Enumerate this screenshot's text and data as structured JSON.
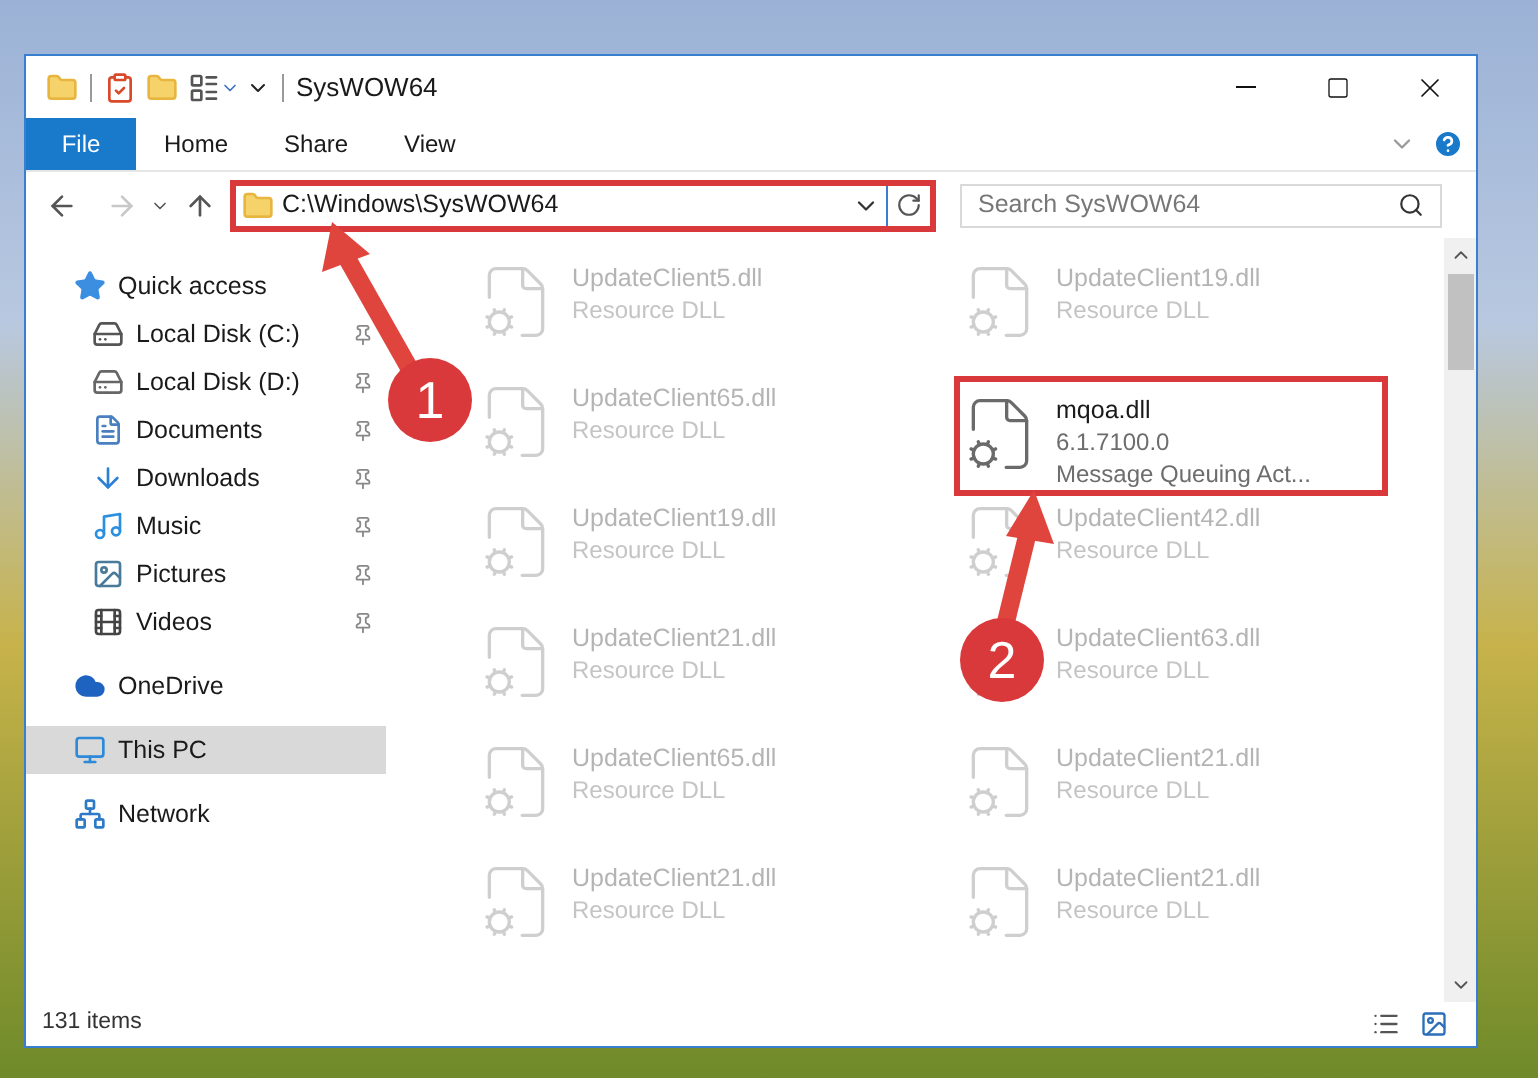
{
  "window": {
    "title": "SysWOW64"
  },
  "ribbon": {
    "file_tab": "File",
    "tabs": [
      "Home",
      "Share",
      "View"
    ]
  },
  "address_bar": {
    "path": "C:\\Windows\\SysWOW64",
    "highlighted": true
  },
  "search": {
    "placeholder": "Search SysWOW64"
  },
  "navigation": [
    {
      "label": "Quick access",
      "kind": "star",
      "selected": false,
      "children": [
        {
          "label": "Local Disk (C:)",
          "kind": "system-drive",
          "pinned": true,
          "selected": false
        },
        {
          "label": "Local Disk (D:)",
          "kind": "drive",
          "pinned": true,
          "selected": false
        },
        {
          "label": "Documents",
          "kind": "documents",
          "pinned": true,
          "selected": false
        },
        {
          "label": "Downloads",
          "kind": "downloads",
          "pinned": true,
          "selected": false
        },
        {
          "label": "Music",
          "kind": "music",
          "pinned": true,
          "selected": false
        },
        {
          "label": "Pictures",
          "kind": "pictures",
          "pinned": true,
          "selected": false
        },
        {
          "label": "Videos",
          "kind": "videos",
          "pinned": true,
          "selected": false
        }
      ]
    },
    {
      "label": "OneDrive",
      "kind": "cloud",
      "selected": false
    },
    {
      "label": "This PC",
      "kind": "computer",
      "selected": true
    },
    {
      "label": "Network",
      "kind": "network",
      "selected": false
    }
  ],
  "files": [
    {
      "kind": "dimmed",
      "lines": [
        "UpdateClient5.dll",
        "Resource DLL"
      ]
    },
    {
      "kind": "dimmed",
      "lines": [
        "UpdateClient19.dll",
        "Resource DLL"
      ]
    },
    {
      "kind": "dimmed",
      "lines": [
        "UpdateClient65.dll",
        "Resource DLL"
      ]
    },
    {
      "kind": "highlighted",
      "lines": [
        "mqoa.dll",
        "6.1.7100.0",
        "Message Queuing Act..."
      ]
    },
    {
      "kind": "dimmed",
      "lines": [
        "UpdateClient19.dll",
        "Resource DLL"
      ]
    },
    {
      "kind": "dimmed",
      "lines": [
        "UpdateClient42.dll",
        "Resource DLL"
      ]
    },
    {
      "kind": "dimmed",
      "lines": [
        "UpdateClient21.dll",
        "Resource DLL"
      ]
    },
    {
      "kind": "dimmed",
      "lines": [
        "UpdateClient63.dll",
        "Resource DLL"
      ]
    },
    {
      "kind": "dimmed",
      "lines": [
        "UpdateClient65.dll",
        "Resource DLL"
      ]
    },
    {
      "kind": "dimmed",
      "lines": [
        "UpdateClient21.dll",
        "Resource DLL"
      ]
    },
    {
      "kind": "dimmed",
      "lines": [
        "UpdateClient21.dll",
        "Resource DLL"
      ]
    },
    {
      "kind": "dimmed",
      "lines": [
        "UpdateClient21.dll",
        "Resource DLL"
      ]
    }
  ],
  "status_bar": {
    "item_count": "131 items"
  },
  "annotations": [
    {
      "number": "1"
    },
    {
      "number": "2"
    }
  ]
}
